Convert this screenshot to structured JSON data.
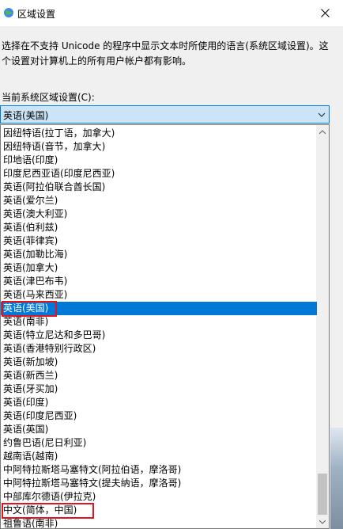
{
  "window": {
    "title": "区域设置",
    "close_label": "✕"
  },
  "description": "选择在不支持 Unicode 的程序中显示文本时所使用的语言(系统区域设置)。这个设置对计算机上的所有用户帐户都有影响。",
  "current_label": "当前系统区域设置(C):",
  "combo_value": "英语(美国)",
  "options": [
    "因纽特语(拉丁语，加拿大)",
    "因纽特语(音节，加拿大)",
    "印地语(印度)",
    "印度尼西亚语(印度尼西亚)",
    "英语(阿拉伯联合酋长国)",
    "英语(爱尔兰)",
    "英语(澳大利亚)",
    "英语(伯利兹)",
    "英语(菲律宾)",
    "英语(加勒比海)",
    "英语(加拿大)",
    "英语(津巴布韦)",
    "英语(马来西亚)",
    "英语(美国)",
    "英语(南非)",
    "英语(特立尼达和多巴哥)",
    "英语(香港特别行政区)",
    "英语(新加坡)",
    "英语(新西兰)",
    "英语(牙买加)",
    "英语(印度)",
    "英语(印度尼西亚)",
    "英语(英国)",
    "约鲁巴语(尼日利亚)",
    "越南语(越南)",
    "中阿特拉斯塔马塞特文(阿拉伯语，摩洛哥)",
    "中阿特拉斯塔马塞特文(提夫纳语，摩洛哥)",
    "中部库尔德语(伊拉克)",
    "中文(简体，中国)",
    "祖鲁语(南非)"
  ],
  "selected_index": 13,
  "highlighted_indices": [
    13,
    28
  ],
  "colors": {
    "selection": "#0078d7",
    "highlight_box": "#e0151d"
  }
}
